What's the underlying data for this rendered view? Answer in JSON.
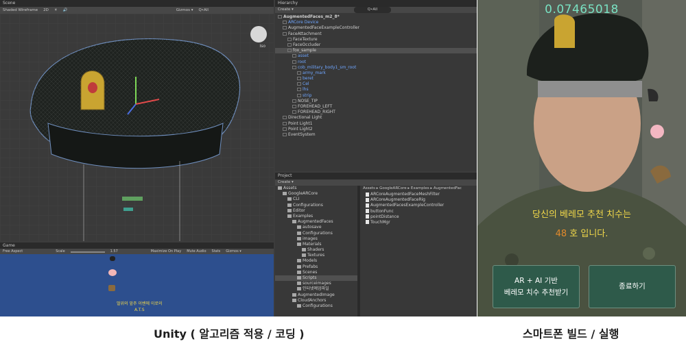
{
  "unity": {
    "scene": {
      "tab": "Scene",
      "toolbar": [
        "Shaded Wireframe",
        "2D",
        "☀",
        "🔊",
        "Gizmos ▾",
        "Q•All"
      ],
      "iso_label": "Iso"
    },
    "game": {
      "tab": "Game",
      "toolbar": [
        "Free Aspect",
        "Scale",
        "1.57",
        "Maximize On Play",
        "Mute Audio",
        "Stats",
        "Gizmos ▾"
      ],
      "overlay_lines": [
        "멀위의 앞주 이벤에 이로의",
        "A.T.S"
      ]
    },
    "hierarchy": {
      "tab": "Hierarchy",
      "create_label": "Create ▾",
      "search_placeholder": "Q•All",
      "items": [
        {
          "label": "AugmentedFaces_m2_8*",
          "depth": 0,
          "style": "bold"
        },
        {
          "label": "ARCore Device",
          "depth": 1,
          "style": "blue"
        },
        {
          "label": "AugmentedFaceExampleController",
          "depth": 1,
          "style": "normal"
        },
        {
          "label": "FaceAttachment",
          "depth": 1,
          "style": "normal"
        },
        {
          "label": "FaceTexture",
          "depth": 2,
          "style": "normal"
        },
        {
          "label": "FaceOccluder",
          "depth": 2,
          "style": "normal"
        },
        {
          "label": "fox_sample",
          "depth": 2,
          "style": "selected"
        },
        {
          "label": "asset",
          "depth": 3,
          "style": "blue"
        },
        {
          "label": "root",
          "depth": 3,
          "style": "blue"
        },
        {
          "label": "cob_military_body1_sm_root",
          "depth": 3,
          "style": "blue"
        },
        {
          "label": "army_mark",
          "depth": 4,
          "style": "blue"
        },
        {
          "label": "beret",
          "depth": 4,
          "style": "blue"
        },
        {
          "label": "Cel",
          "depth": 4,
          "style": "blue"
        },
        {
          "label": "lhs",
          "depth": 4,
          "style": "blue"
        },
        {
          "label": "strip",
          "depth": 4,
          "style": "blue"
        },
        {
          "label": "NOSE_TIP",
          "depth": 3,
          "style": "normal"
        },
        {
          "label": "FOREHEAD_LEFT",
          "depth": 3,
          "style": "normal"
        },
        {
          "label": "FOREHEAD_RIGHT",
          "depth": 3,
          "style": "normal"
        },
        {
          "label": "Directional Light",
          "depth": 1,
          "style": "normal"
        },
        {
          "label": "Point Light1",
          "depth": 1,
          "style": "normal"
        },
        {
          "label": "Point Light2",
          "depth": 1,
          "style": "normal"
        },
        {
          "label": "EventSystem",
          "depth": 1,
          "style": "normal"
        }
      ]
    },
    "project": {
      "tab": "Project",
      "create_label": "Create ▾",
      "breadcrumb": "Assets ▸ GoogleARCore ▸ Examples ▸ AugmentedFac",
      "folders": [
        {
          "label": "Assets",
          "depth": 0
        },
        {
          "label": "GoogleARCore",
          "depth": 1
        },
        {
          "label": "CLI",
          "depth": 2
        },
        {
          "label": "Configurations",
          "depth": 2
        },
        {
          "label": "Editor",
          "depth": 2
        },
        {
          "label": "Examples",
          "depth": 2
        },
        {
          "label": "AugmentedFaces",
          "depth": 3
        },
        {
          "label": "autosave",
          "depth": 4
        },
        {
          "label": "Configurations",
          "depth": 4
        },
        {
          "label": "images",
          "depth": 4
        },
        {
          "label": "Materials",
          "depth": 4
        },
        {
          "label": "Shaders",
          "depth": 5
        },
        {
          "label": "Textures",
          "depth": 5
        },
        {
          "label": "Models",
          "depth": 4
        },
        {
          "label": "Prefabs",
          "depth": 4
        },
        {
          "label": "Scenes",
          "depth": 4
        },
        {
          "label": "Scripts",
          "depth": 4
        },
        {
          "label": "sourceimages",
          "depth": 4
        },
        {
          "label": "인터넷예업파일",
          "depth": 4
        },
        {
          "label": "AugmentedImage",
          "depth": 3
        },
        {
          "label": "CloudAnchors",
          "depth": 3
        },
        {
          "label": "Configurations",
          "depth": 4
        }
      ],
      "files": [
        "ARCoreAugmentedFaceMeshFilter",
        "ARCoreAugmentedFaceRig",
        "AugmentedFacesExampleController",
        "buttonFunc",
        "pointDistance",
        "TouchMgr"
      ]
    }
  },
  "phone": {
    "distance_value": "0.07465018",
    "result_line1": "당신의 베레모 추천 치수는",
    "result_size": "48",
    "result_line2_suffix": "호 입니다.",
    "recommend_button": [
      "AR + AI 기반",
      "베레모 치수 추천받기"
    ],
    "exit_button": "종료하기",
    "colors": {
      "button_bg": "#2e5a4a",
      "result_text": "#f2d94a",
      "size_highlight": "#e28a2c",
      "distance_text": "#79e2c3"
    }
  },
  "captions": {
    "left": "Unity ( 알고리즘 적용 / 코딩 )",
    "right": "스마트폰 빌드 / 실행"
  }
}
